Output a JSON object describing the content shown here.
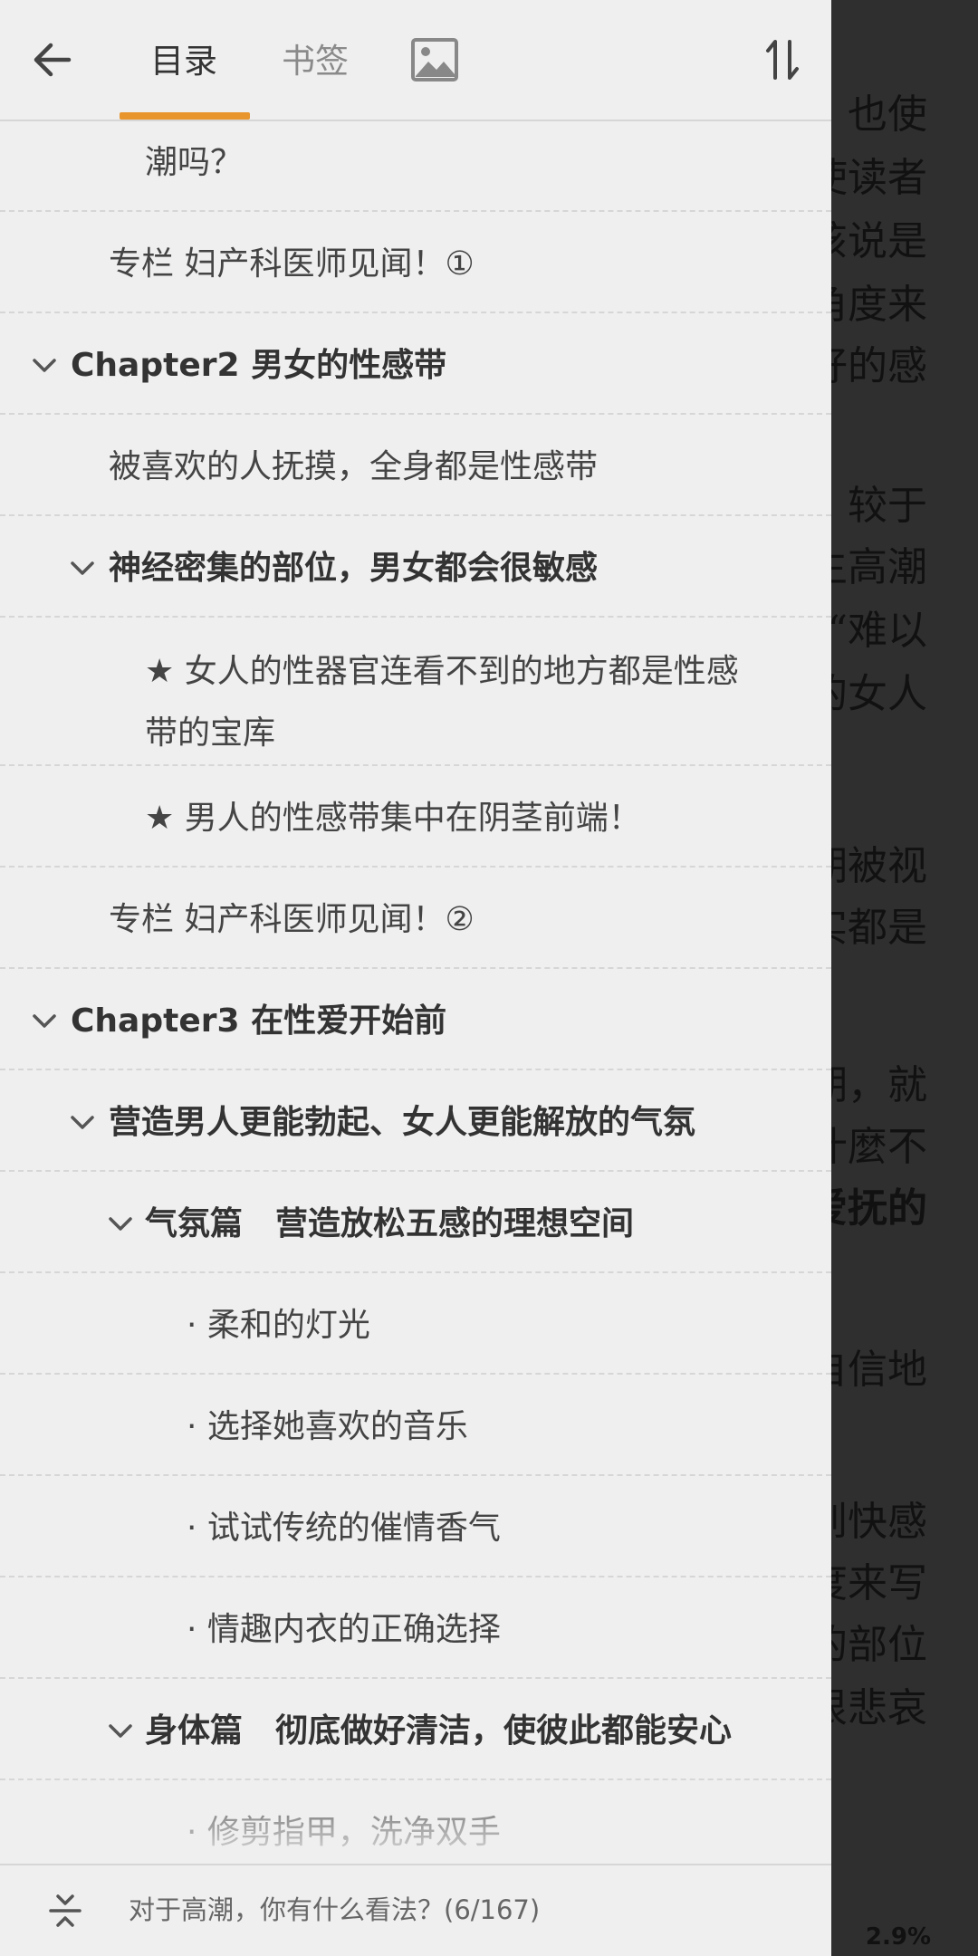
{
  "tabs": {
    "toc": "目录",
    "bookmarks": "书签"
  },
  "colors": {
    "accent": "#e8952e",
    "drawer_bg": "#efefef",
    "reader_bg": "#2f2f2f"
  },
  "icons": {
    "back": "arrow-left",
    "image": "image",
    "sort": "sort-order",
    "locate": "locate-current"
  },
  "toc": [
    {
      "text": "潮吗？",
      "bold": false,
      "expanded": null
    },
    {
      "text": "专栏 妇产科医师见闻！①",
      "bold": false,
      "expanded": null
    },
    {
      "text": "Chapter2 男女的性感带",
      "bold": true,
      "expanded": true
    },
    {
      "text": "被喜欢的人抚摸，全身都是性感带",
      "bold": false,
      "expanded": null
    },
    {
      "text": "神经密集的部位，男女都会很敏感",
      "bold": true,
      "expanded": true
    },
    {
      "text": "★ 女人的性器官连看不到的地方都是性感",
      "text2": "带的宝库",
      "bold": false,
      "expanded": null
    },
    {
      "text": "★ 男人的性感带集中在阴茎前端！",
      "bold": false,
      "expanded": null
    },
    {
      "text": "专栏 妇产科医师见闻！②",
      "bold": false,
      "expanded": null
    },
    {
      "text": "Chapter3 在性爱开始前",
      "bold": true,
      "expanded": true
    },
    {
      "text": "营造男人更能勃起、女人更能解放的气氛",
      "bold": true,
      "expanded": true
    },
    {
      "text": "气氛篇　营造放松五感的理想空间",
      "bold": true,
      "expanded": true
    },
    {
      "text": "· 柔和的灯光",
      "bold": false,
      "expanded": null
    },
    {
      "text": "· 选择她喜欢的音乐",
      "bold": false,
      "expanded": null
    },
    {
      "text": "· 试试传统的催情香气",
      "bold": false,
      "expanded": null
    },
    {
      "text": "· 情趣内衣的正确选择",
      "bold": false,
      "expanded": null
    },
    {
      "text": "身体篇　彻底做好清洁，使彼此都能安心",
      "bold": true,
      "expanded": true
    },
    {
      "text": "· 修剪指甲，洗净双手",
      "bold": false,
      "expanded": null
    }
  ],
  "current_position": "对于高潮，你有什么看法？(6/167)",
  "reader": {
    "lines": [
      "也使",
      "使读者",
      "该说是",
      "角度来",
      "好的感",
      "较于",
      "生高潮",
      "“难以",
      "的女人",
      "期被视",
      "实都是",
      "期，就",
      "什麼不",
      "爱抚的",
      "自信地",
      "到快感",
      "度来写",
      "的部位",
      "很悲哀"
    ],
    "percent": "2.9%"
  }
}
